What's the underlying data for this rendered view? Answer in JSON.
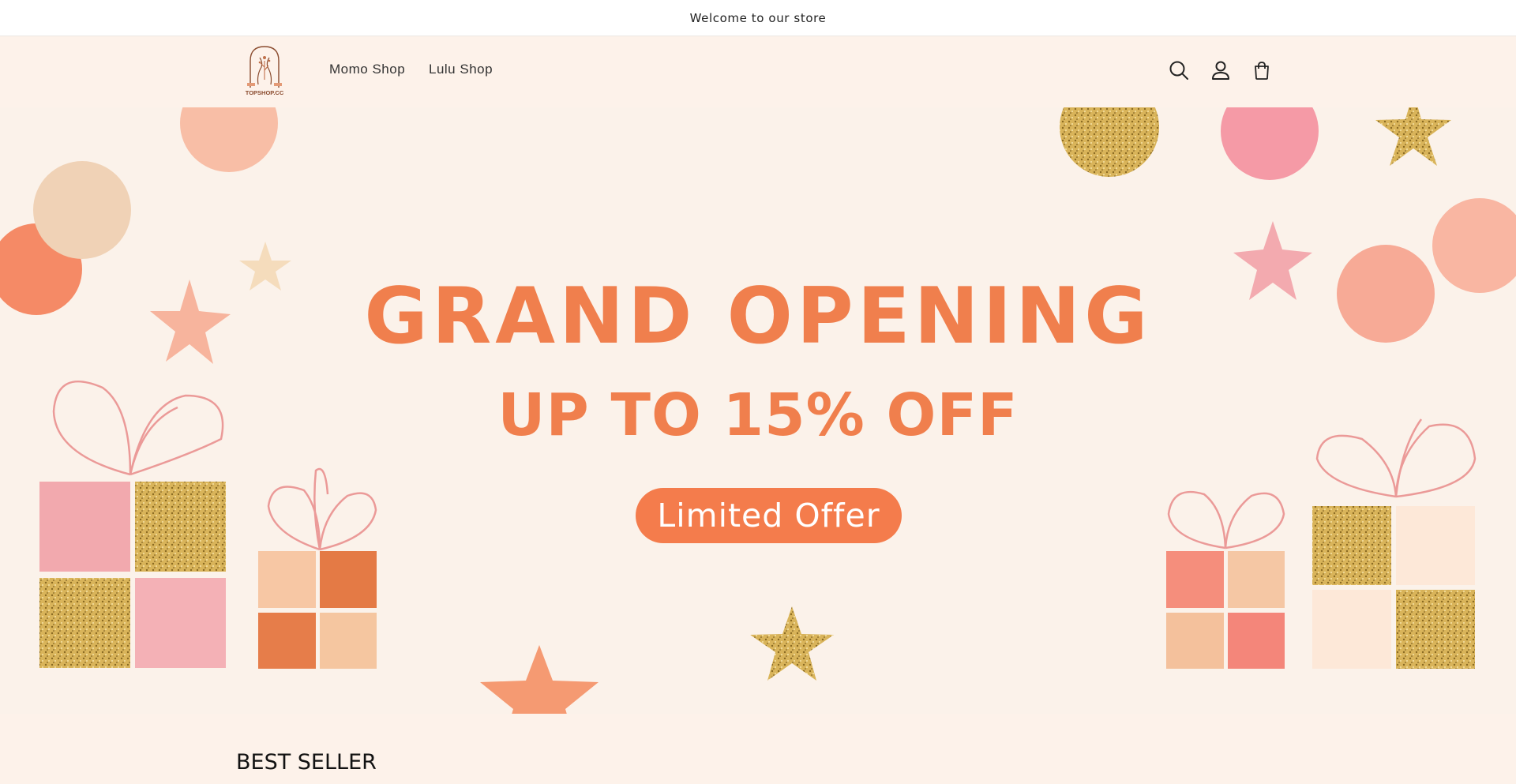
{
  "announcement": {
    "text": "Welcome to our store"
  },
  "header": {
    "logo_text": "TOPSHOP.CC",
    "nav": [
      {
        "label": "Momo Shop"
      },
      {
        "label": "Lulu Shop"
      }
    ],
    "icons": [
      "search-icon",
      "account-icon",
      "cart-icon"
    ]
  },
  "hero": {
    "headline": "GRAND OPENING",
    "subheadline": "UP TO 15% OFF",
    "button_label": "Limited Offer",
    "colors": {
      "accent": "#f07f4d",
      "gold": "#d9b45a",
      "pink": "#f2a3a8",
      "background": "#fbf2ea"
    }
  },
  "sections": {
    "best_seller_title": "BEST SELLER"
  }
}
